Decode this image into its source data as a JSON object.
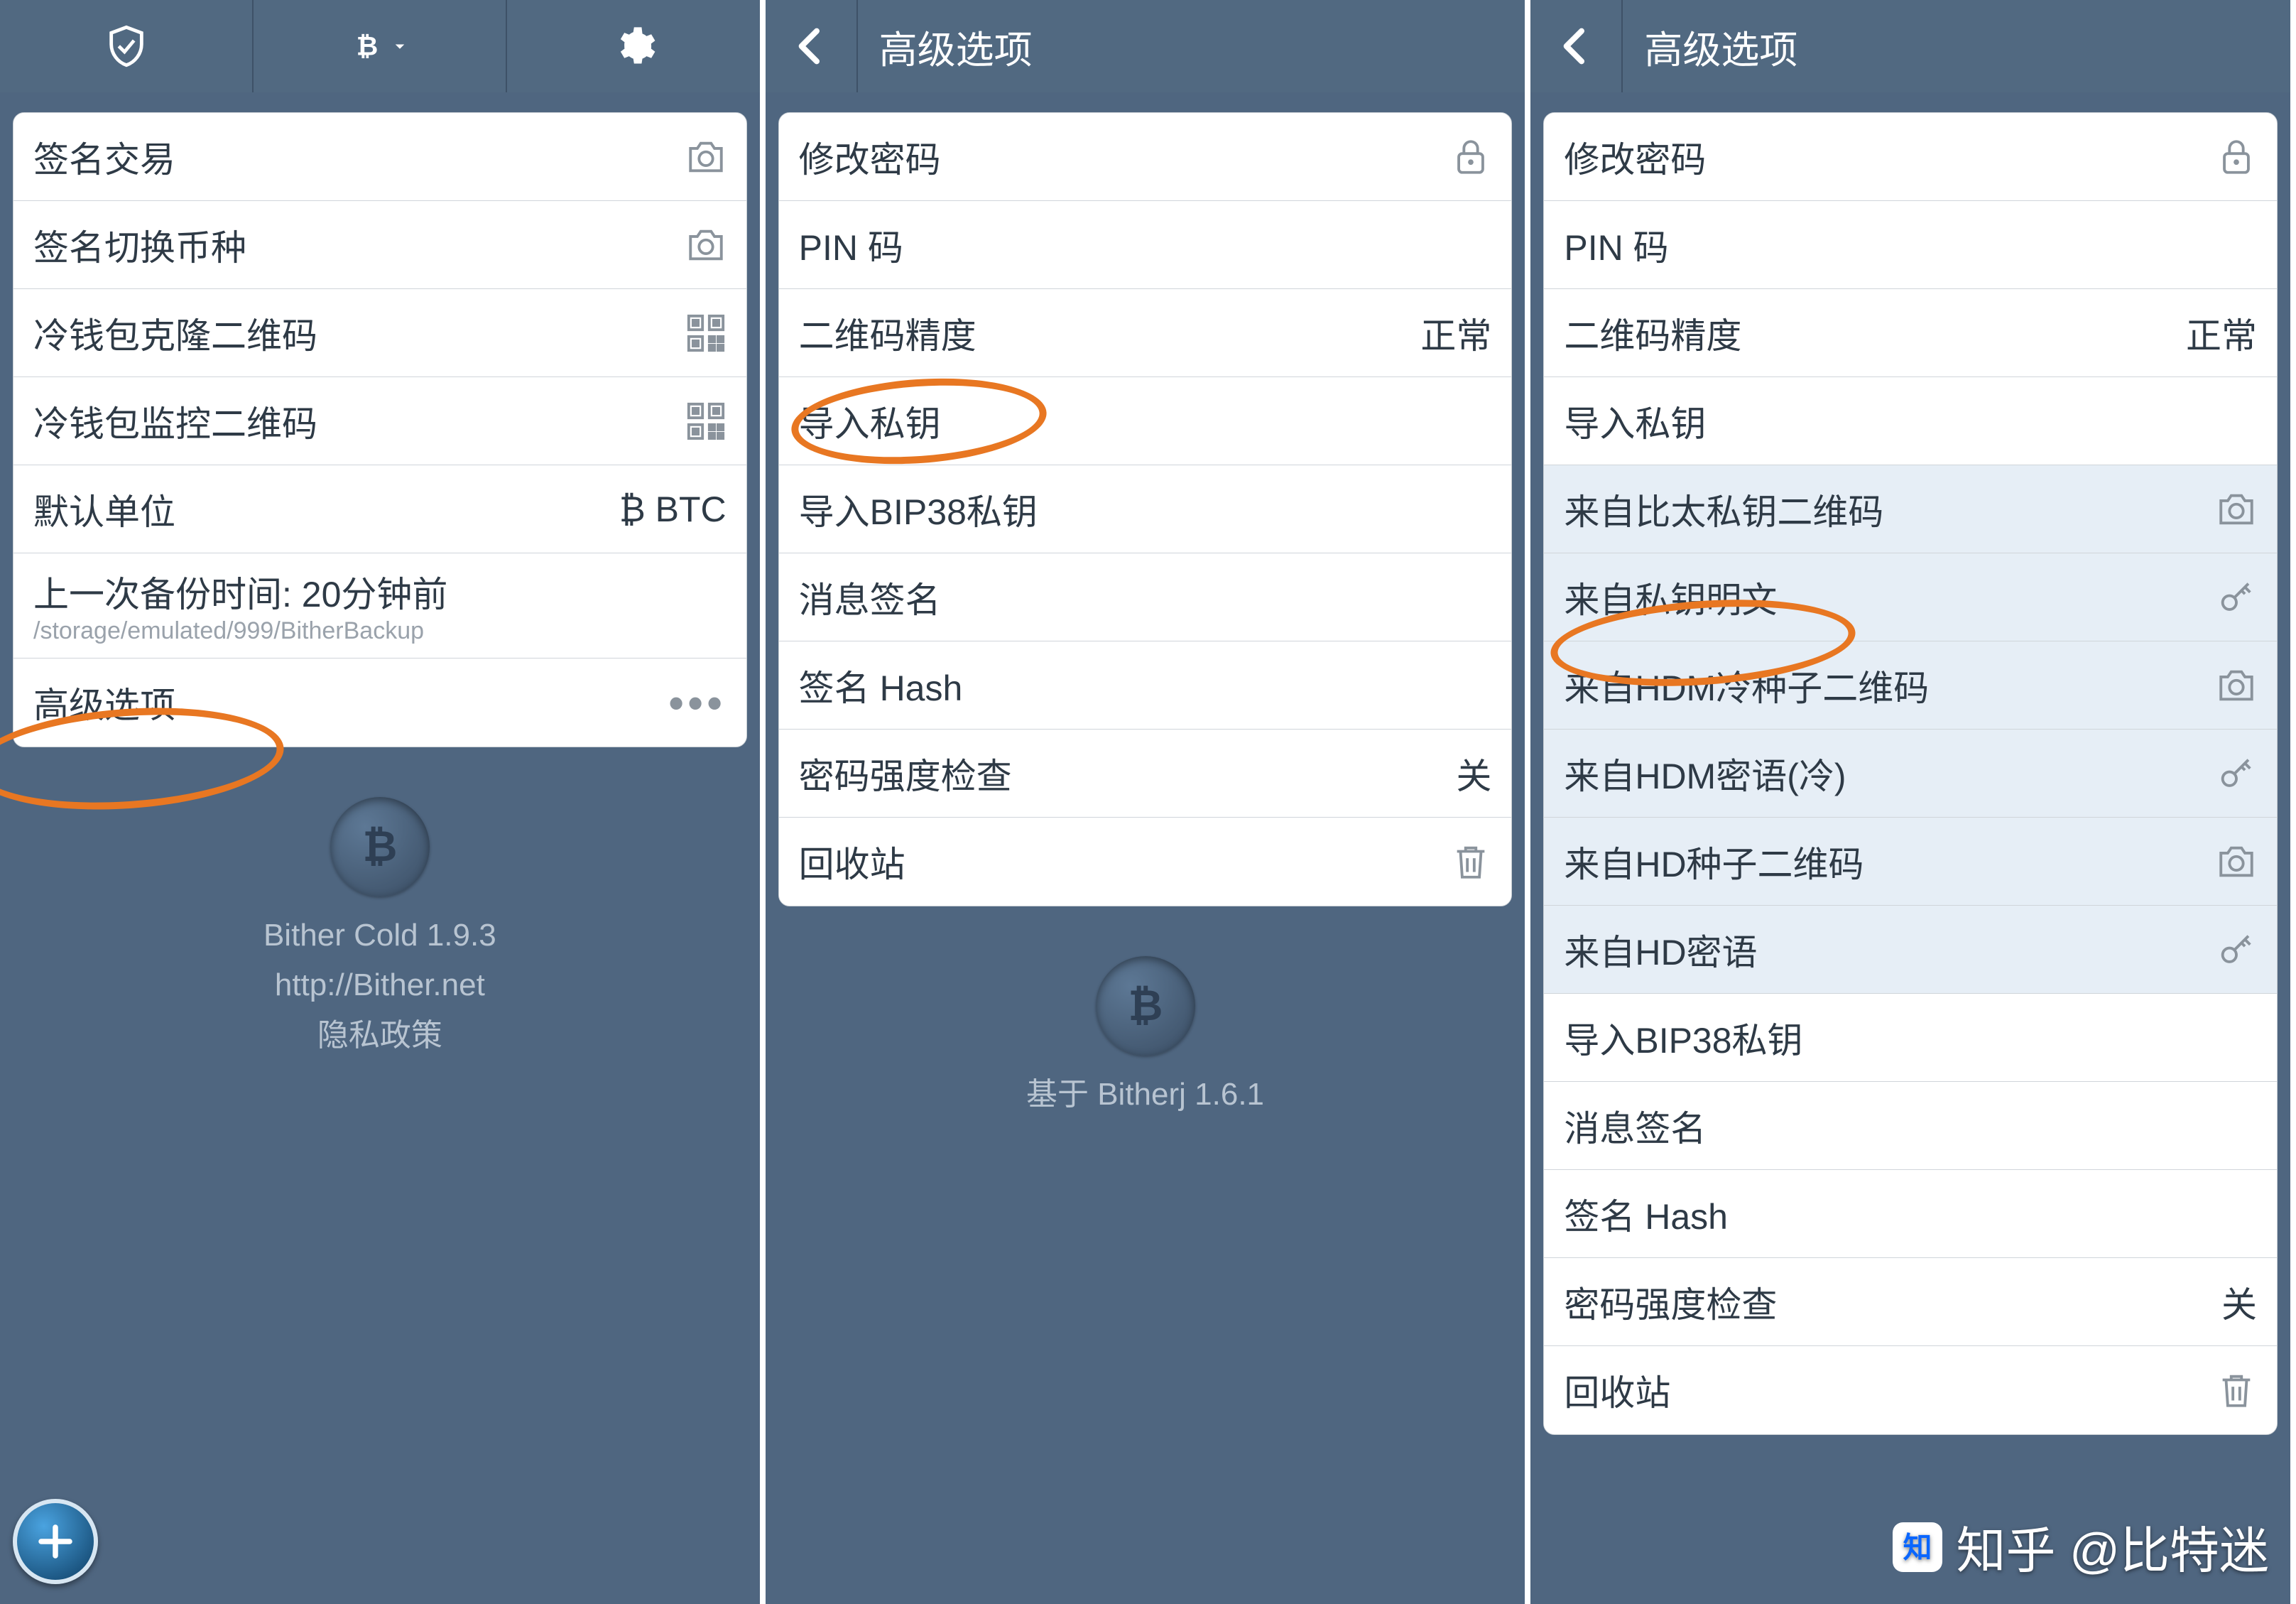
{
  "screen1": {
    "rows": [
      {
        "label": "签名交易",
        "icon": "camera"
      },
      {
        "label": "签名切换币种",
        "icon": "camera"
      },
      {
        "label": "冷钱包克隆二维码",
        "icon": "qr"
      },
      {
        "label": "冷钱包监控二维码",
        "icon": "qr"
      },
      {
        "label": "默认单位",
        "trail": "₿ BTC"
      },
      {
        "label": "上一次备份时间: 20分钟前",
        "sub": "/storage/emulated/999/BitherBackup"
      },
      {
        "label": "高级选项",
        "icon": "dots"
      }
    ],
    "footer": {
      "line1": "Bither Cold 1.9.3",
      "line2": "http://Bither.net",
      "line3": "隐私政策"
    }
  },
  "screen2": {
    "title": "高级选项",
    "rows": [
      {
        "label": "修改密码",
        "icon": "lock"
      },
      {
        "label": "PIN 码"
      },
      {
        "label": "二维码精度",
        "trail": "正常"
      },
      {
        "label": "导入私钥"
      },
      {
        "label": "导入BIP38私钥"
      },
      {
        "label": "消息签名"
      },
      {
        "label": "签名 Hash"
      },
      {
        "label": "密码强度检查",
        "trail": "关"
      },
      {
        "label": "回收站",
        "icon": "trash"
      }
    ],
    "footer": "基于 Bitherj 1.6.1"
  },
  "screen3": {
    "title": "高级选项",
    "rows": [
      {
        "label": "修改密码",
        "icon": "lock"
      },
      {
        "label": "PIN 码"
      },
      {
        "label": "二维码精度",
        "trail": "正常"
      },
      {
        "label": "导入私钥"
      },
      {
        "label": "来自比太私钥二维码",
        "icon": "camera",
        "tint": true
      },
      {
        "label": "来自私钥明文",
        "icon": "key",
        "tint": true
      },
      {
        "label": "来自HDM冷种子二维码",
        "icon": "camera",
        "tint": true
      },
      {
        "label": "来自HDM密语(冷)",
        "icon": "key",
        "tint": true
      },
      {
        "label": "来自HD种子二维码",
        "icon": "camera",
        "tint": true
      },
      {
        "label": "来自HD密语",
        "icon": "key",
        "tint": true
      },
      {
        "label": "导入BIP38私钥"
      },
      {
        "label": "消息签名"
      },
      {
        "label": "签名 Hash"
      },
      {
        "label": "密码强度检查",
        "trail": "关"
      },
      {
        "label": "回收站",
        "icon": "trash"
      }
    ]
  },
  "watermark": "知乎 @比特迷"
}
